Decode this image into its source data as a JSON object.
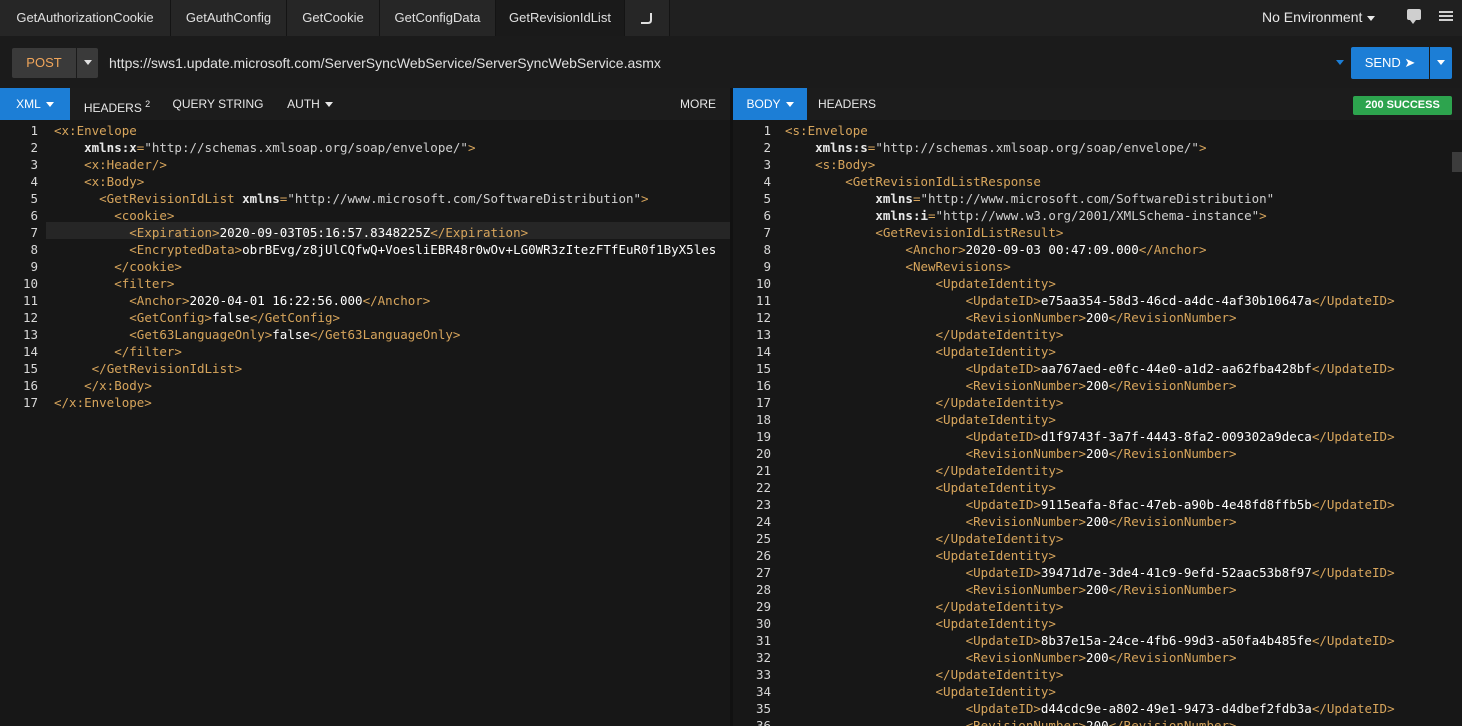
{
  "tabs": [
    "GetAuthorizationCookie",
    "GetAuthConfig",
    "GetCookie",
    "GetConfigData",
    "GetRevisionIdList"
  ],
  "new_tab_icon": "new-tab-icon",
  "environment": "No Environment",
  "method": "POST",
  "url": "https://sws1.update.microsoft.com/ServerSyncWebService/ServerSyncWebService.asmx",
  "send_label": "SEND ➤",
  "request_tabs": {
    "xml": "XML",
    "headers": "HEADERS",
    "headers_count": "2",
    "query": "QUERY STRING",
    "auth": "AUTH",
    "more": "MORE"
  },
  "response_tabs": {
    "body": "BODY",
    "headers": "HEADERS"
  },
  "status": "200 SUCCESS",
  "colors": {
    "accent": "#1c7ed6",
    "success": "#2da44e",
    "method": "#f0a55a",
    "tag": "#d7a55c"
  },
  "request_lines": [
    [
      {
        "c": "tag",
        "t": "<x:Envelope"
      }
    ],
    [
      {
        "c": "",
        "t": "    "
      },
      {
        "c": "attr",
        "t": "xmlns:x"
      },
      {
        "c": "tag",
        "t": "="
      },
      {
        "c": "str",
        "t": "\"http://schemas.xmlsoap.org/soap/envelope/\""
      },
      {
        "c": "tag",
        "t": ">"
      }
    ],
    [
      {
        "c": "",
        "t": "    "
      },
      {
        "c": "tag",
        "t": "<x:Header/>"
      }
    ],
    [
      {
        "c": "",
        "t": "    "
      },
      {
        "c": "tag",
        "t": "<x:Body>"
      }
    ],
    [
      {
        "c": "",
        "t": "      "
      },
      {
        "c": "tag",
        "t": "<GetRevisionIdList "
      },
      {
        "c": "attr",
        "t": "xmlns"
      },
      {
        "c": "tag",
        "t": "="
      },
      {
        "c": "str",
        "t": "\"http://www.microsoft.com/SoftwareDistribution\""
      },
      {
        "c": "tag",
        "t": ">"
      }
    ],
    [
      {
        "c": "",
        "t": "        "
      },
      {
        "c": "tag",
        "t": "<cookie>"
      }
    ],
    [
      {
        "c": "",
        "t": "          "
      },
      {
        "c": "tag",
        "t": "<Expiration>"
      },
      {
        "c": "txt",
        "t": "2020-09-03T05:16:57.8348225Z"
      },
      {
        "c": "tag",
        "t": "</Expiration>"
      }
    ],
    [
      {
        "c": "",
        "t": "          "
      },
      {
        "c": "tag",
        "t": "<EncryptedData>"
      },
      {
        "c": "txt",
        "t": "obrBEvg/z8jUlCQfwQ+VoesliEBR48r0wOv+LG0WR3zItezFTfEuR0f1ByX5les"
      }
    ],
    [
      {
        "c": "",
        "t": "        "
      },
      {
        "c": "tag",
        "t": "</cookie>"
      }
    ],
    [
      {
        "c": "",
        "t": "        "
      },
      {
        "c": "tag",
        "t": "<filter>"
      }
    ],
    [
      {
        "c": "",
        "t": "          "
      },
      {
        "c": "tag",
        "t": "<Anchor>"
      },
      {
        "c": "txt",
        "t": "2020-04-01 16:22:56.000"
      },
      {
        "c": "tag",
        "t": "</Anchor>"
      }
    ],
    [
      {
        "c": "",
        "t": "          "
      },
      {
        "c": "tag",
        "t": "<GetConfig>"
      },
      {
        "c": "txt",
        "t": "false"
      },
      {
        "c": "tag",
        "t": "</GetConfig>"
      }
    ],
    [
      {
        "c": "",
        "t": "          "
      },
      {
        "c": "tag",
        "t": "<Get63LanguageOnly>"
      },
      {
        "c": "txt",
        "t": "false"
      },
      {
        "c": "tag",
        "t": "</Get63LanguageOnly>"
      }
    ],
    [
      {
        "c": "",
        "t": "        "
      },
      {
        "c": "tag",
        "t": "</filter>"
      }
    ],
    [
      {
        "c": "",
        "t": "     "
      },
      {
        "c": "tag",
        "t": "</GetRevisionIdList>"
      }
    ],
    [
      {
        "c": "",
        "t": "    "
      },
      {
        "c": "tag",
        "t": "</x:Body>"
      }
    ],
    [
      {
        "c": "tag",
        "t": "</x:Envelope>"
      }
    ]
  ],
  "response_lines": [
    [
      {
        "c": "tag",
        "t": "<s:Envelope"
      }
    ],
    [
      {
        "c": "",
        "t": "    "
      },
      {
        "c": "attr",
        "t": "xmlns:s"
      },
      {
        "c": "tag",
        "t": "="
      },
      {
        "c": "str",
        "t": "\"http://schemas.xmlsoap.org/soap/envelope/\""
      },
      {
        "c": "tag",
        "t": ">"
      }
    ],
    [
      {
        "c": "",
        "t": "    "
      },
      {
        "c": "tag",
        "t": "<s:Body>"
      }
    ],
    [
      {
        "c": "",
        "t": "        "
      },
      {
        "c": "tag",
        "t": "<GetRevisionIdListResponse"
      }
    ],
    [
      {
        "c": "",
        "t": "            "
      },
      {
        "c": "attr",
        "t": "xmlns"
      },
      {
        "c": "tag",
        "t": "="
      },
      {
        "c": "str",
        "t": "\"http://www.microsoft.com/SoftwareDistribution\""
      }
    ],
    [
      {
        "c": "",
        "t": "            "
      },
      {
        "c": "attr",
        "t": "xmlns:i"
      },
      {
        "c": "tag",
        "t": "="
      },
      {
        "c": "str",
        "t": "\"http://www.w3.org/2001/XMLSchema-instance\""
      },
      {
        "c": "tag",
        "t": ">"
      }
    ],
    [
      {
        "c": "",
        "t": "            "
      },
      {
        "c": "tag",
        "t": "<GetRevisionIdListResult>"
      }
    ],
    [
      {
        "c": "",
        "t": "                "
      },
      {
        "c": "tag",
        "t": "<Anchor>"
      },
      {
        "c": "txt",
        "t": "2020-09-03 00:47:09.000"
      },
      {
        "c": "tag",
        "t": "</Anchor>"
      }
    ],
    [
      {
        "c": "",
        "t": "                "
      },
      {
        "c": "tag",
        "t": "<NewRevisions>"
      }
    ],
    [
      {
        "c": "",
        "t": "                    "
      },
      {
        "c": "tag",
        "t": "<UpdateIdentity>"
      }
    ],
    [
      {
        "c": "",
        "t": "                        "
      },
      {
        "c": "tag",
        "t": "<UpdateID>"
      },
      {
        "c": "txt",
        "t": "e75aa354-58d3-46cd-a4dc-4af30b10647a"
      },
      {
        "c": "tag",
        "t": "</UpdateID>"
      }
    ],
    [
      {
        "c": "",
        "t": "                        "
      },
      {
        "c": "tag",
        "t": "<RevisionNumber>"
      },
      {
        "c": "txt",
        "t": "200"
      },
      {
        "c": "tag",
        "t": "</RevisionNumber>"
      }
    ],
    [
      {
        "c": "",
        "t": "                    "
      },
      {
        "c": "tag",
        "t": "</UpdateIdentity>"
      }
    ],
    [
      {
        "c": "",
        "t": "                    "
      },
      {
        "c": "tag",
        "t": "<UpdateIdentity>"
      }
    ],
    [
      {
        "c": "",
        "t": "                        "
      },
      {
        "c": "tag",
        "t": "<UpdateID>"
      },
      {
        "c": "txt",
        "t": "aa767aed-e0fc-44e0-a1d2-aa62fba428bf"
      },
      {
        "c": "tag",
        "t": "</UpdateID>"
      }
    ],
    [
      {
        "c": "",
        "t": "                        "
      },
      {
        "c": "tag",
        "t": "<RevisionNumber>"
      },
      {
        "c": "txt",
        "t": "200"
      },
      {
        "c": "tag",
        "t": "</RevisionNumber>"
      }
    ],
    [
      {
        "c": "",
        "t": "                    "
      },
      {
        "c": "tag",
        "t": "</UpdateIdentity>"
      }
    ],
    [
      {
        "c": "",
        "t": "                    "
      },
      {
        "c": "tag",
        "t": "<UpdateIdentity>"
      }
    ],
    [
      {
        "c": "",
        "t": "                        "
      },
      {
        "c": "tag",
        "t": "<UpdateID>"
      },
      {
        "c": "txt",
        "t": "d1f9743f-3a7f-4443-8fa2-009302a9deca"
      },
      {
        "c": "tag",
        "t": "</UpdateID>"
      }
    ],
    [
      {
        "c": "",
        "t": "                        "
      },
      {
        "c": "tag",
        "t": "<RevisionNumber>"
      },
      {
        "c": "txt",
        "t": "200"
      },
      {
        "c": "tag",
        "t": "</RevisionNumber>"
      }
    ],
    [
      {
        "c": "",
        "t": "                    "
      },
      {
        "c": "tag",
        "t": "</UpdateIdentity>"
      }
    ],
    [
      {
        "c": "",
        "t": "                    "
      },
      {
        "c": "tag",
        "t": "<UpdateIdentity>"
      }
    ],
    [
      {
        "c": "",
        "t": "                        "
      },
      {
        "c": "tag",
        "t": "<UpdateID>"
      },
      {
        "c": "txt",
        "t": "9115eafa-8fac-47eb-a90b-4e48fd8ffb5b"
      },
      {
        "c": "tag",
        "t": "</UpdateID>"
      }
    ],
    [
      {
        "c": "",
        "t": "                        "
      },
      {
        "c": "tag",
        "t": "<RevisionNumber>"
      },
      {
        "c": "txt",
        "t": "200"
      },
      {
        "c": "tag",
        "t": "</RevisionNumber>"
      }
    ],
    [
      {
        "c": "",
        "t": "                    "
      },
      {
        "c": "tag",
        "t": "</UpdateIdentity>"
      }
    ],
    [
      {
        "c": "",
        "t": "                    "
      },
      {
        "c": "tag",
        "t": "<UpdateIdentity>"
      }
    ],
    [
      {
        "c": "",
        "t": "                        "
      },
      {
        "c": "tag",
        "t": "<UpdateID>"
      },
      {
        "c": "txt",
        "t": "39471d7e-3de4-41c9-9efd-52aac53b8f97"
      },
      {
        "c": "tag",
        "t": "</UpdateID>"
      }
    ],
    [
      {
        "c": "",
        "t": "                        "
      },
      {
        "c": "tag",
        "t": "<RevisionNumber>"
      },
      {
        "c": "txt",
        "t": "200"
      },
      {
        "c": "tag",
        "t": "</RevisionNumber>"
      }
    ],
    [
      {
        "c": "",
        "t": "                    "
      },
      {
        "c": "tag",
        "t": "</UpdateIdentity>"
      }
    ],
    [
      {
        "c": "",
        "t": "                    "
      },
      {
        "c": "tag",
        "t": "<UpdateIdentity>"
      }
    ],
    [
      {
        "c": "",
        "t": "                        "
      },
      {
        "c": "tag",
        "t": "<UpdateID>"
      },
      {
        "c": "txt",
        "t": "8b37e15a-24ce-4fb6-99d3-a50fa4b485fe"
      },
      {
        "c": "tag",
        "t": "</UpdateID>"
      }
    ],
    [
      {
        "c": "",
        "t": "                        "
      },
      {
        "c": "tag",
        "t": "<RevisionNumber>"
      },
      {
        "c": "txt",
        "t": "200"
      },
      {
        "c": "tag",
        "t": "</RevisionNumber>"
      }
    ],
    [
      {
        "c": "",
        "t": "                    "
      },
      {
        "c": "tag",
        "t": "</UpdateIdentity>"
      }
    ],
    [
      {
        "c": "",
        "t": "                    "
      },
      {
        "c": "tag",
        "t": "<UpdateIdentity>"
      }
    ],
    [
      {
        "c": "",
        "t": "                        "
      },
      {
        "c": "tag",
        "t": "<UpdateID>"
      },
      {
        "c": "txt",
        "t": "d44cdc9e-a802-49e1-9473-d4dbef2fdb3a"
      },
      {
        "c": "tag",
        "t": "</UpdateID>"
      }
    ],
    [
      {
        "c": "",
        "t": "                        "
      },
      {
        "c": "tag",
        "t": "<RevisionNumber>"
      },
      {
        "c": "txt",
        "t": "200"
      },
      {
        "c": "tag",
        "t": "</RevisionNumber>"
      }
    ]
  ]
}
